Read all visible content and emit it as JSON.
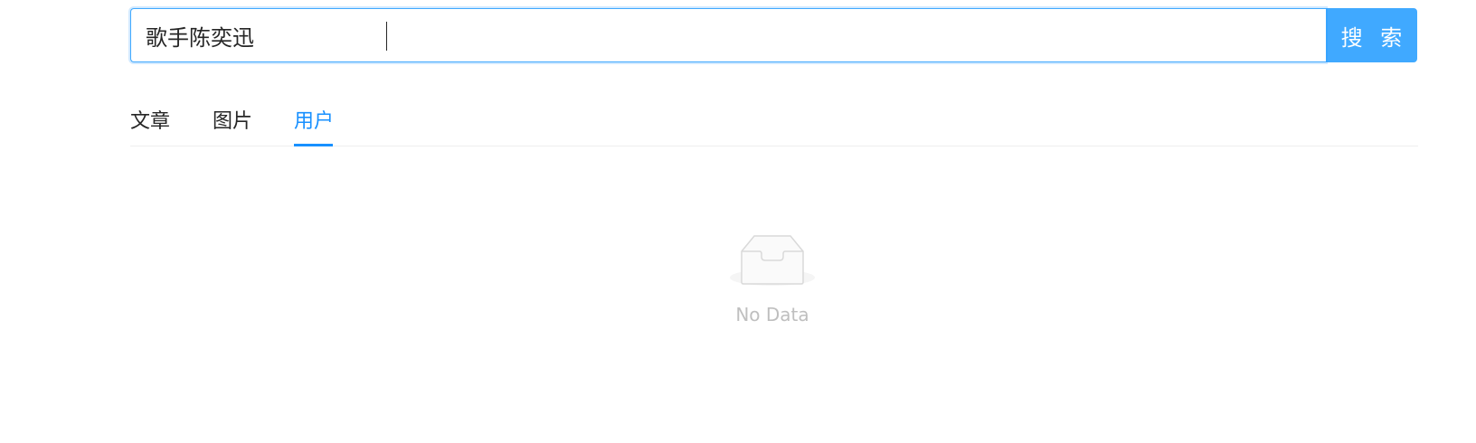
{
  "search": {
    "value": "歌手陈奕迅",
    "button_label": "搜 索"
  },
  "tabs": [
    {
      "label": "文章",
      "active": false
    },
    {
      "label": "图片",
      "active": false
    },
    {
      "label": "用户",
      "active": true
    }
  ],
  "empty_state": {
    "text": "No Data",
    "icon": "empty-inbox-icon"
  },
  "colors": {
    "accent": "#1890ff",
    "button": "#40a9ff",
    "muted_text": "#bfbfbf"
  }
}
